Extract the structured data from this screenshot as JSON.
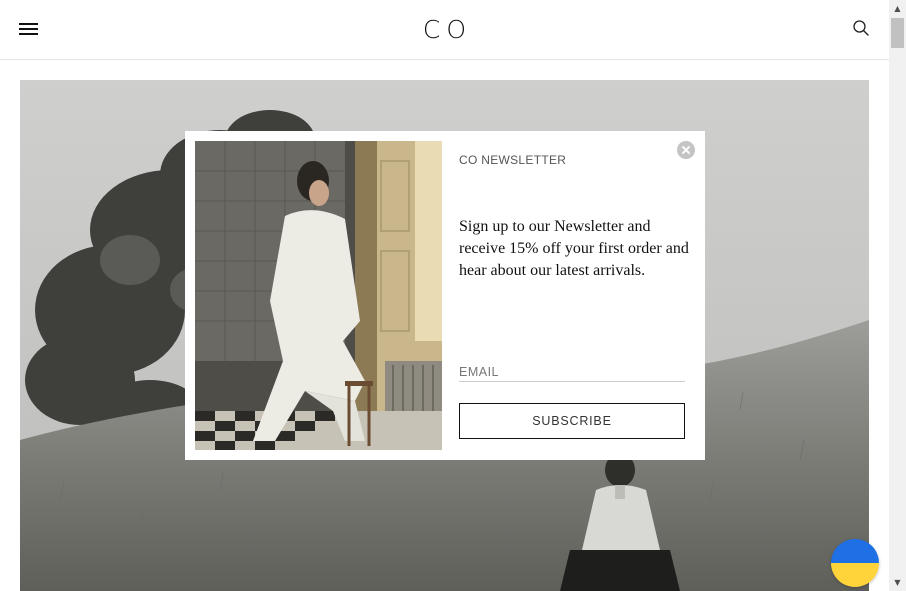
{
  "header": {
    "logo_text": "CO",
    "menu_icon": "hamburger-menu-icon",
    "search_icon": "search-icon"
  },
  "newsletter": {
    "eyebrow": "CO NEWSLETTER",
    "body": "Sign up to our Newsletter and receive 15% off your first order and hear about our latest arrivals.",
    "email_placeholder": "EMAIL",
    "email_value": "",
    "subscribe_label": "SUBSCRIBE",
    "close_icon": "close-icon"
  },
  "support_badge": {
    "icon": "ukraine-flag-icon",
    "colors": {
      "top": "#1f6fe5",
      "bottom": "#ffd43b"
    }
  },
  "scrollbar": {
    "up_glyph": "▲",
    "down_glyph": "▼"
  }
}
